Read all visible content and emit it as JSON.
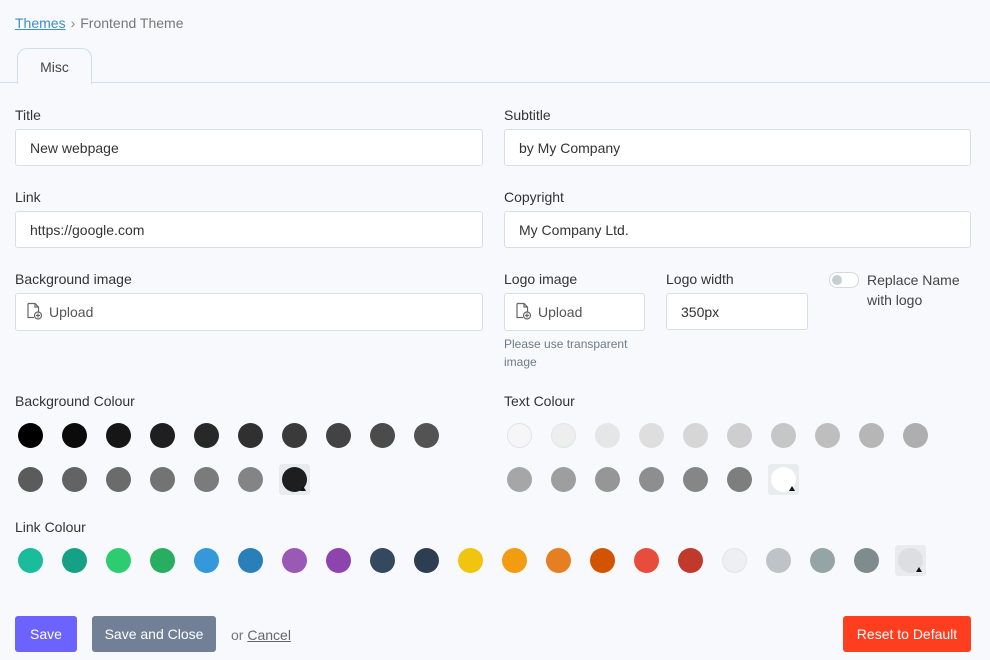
{
  "breadcrumb": {
    "link": "Themes",
    "separator": "›",
    "current": "Frontend Theme"
  },
  "tabs": [
    {
      "label": "Misc"
    }
  ],
  "fields": {
    "title": {
      "label": "Title",
      "value": "New webpage"
    },
    "subtitle": {
      "label": "Subtitle",
      "value": "by My Company"
    },
    "link": {
      "label": "Link",
      "value": "https://google.com"
    },
    "copyright": {
      "label": "Copyright",
      "value": "My Company Ltd."
    },
    "background_image": {
      "label": "Background image",
      "upload": "Upload"
    },
    "logo_image": {
      "label": "Logo image",
      "upload": "Upload",
      "hint": "Please use transparent image"
    },
    "logo_width": {
      "label": "Logo width",
      "value": "350px"
    },
    "replace_name": {
      "label": "Replace Name with logo",
      "checked": false
    }
  },
  "background_colour": {
    "label": "Background Colour",
    "swatches": [
      "#000000",
      "#0b0b0b",
      "#161616",
      "#1f1f1f",
      "#282828",
      "#303030",
      "#3a3a3a",
      "#434343",
      "#4b4b4b",
      "#535353",
      "#5b5b5b",
      "#636363",
      "#6b6b6b",
      "#737373",
      "#7b7b7b",
      "#848484"
    ],
    "selected": "#1e1e1e"
  },
  "text_colour": {
    "label": "Text Colour",
    "swatches": [
      "#f6f6f6",
      "#eeeeee",
      "#e6e6e6",
      "#dedede",
      "#d6d6d6",
      "#cecece",
      "#c6c6c6",
      "#bebebe",
      "#b6b6b6",
      "#aeaeae",
      "#a6a6a6",
      "#9e9e9e",
      "#969696",
      "#8e8e8e",
      "#868686",
      "#7e7e7e"
    ],
    "selected": "#ffffff"
  },
  "link_colour": {
    "label": "Link Colour",
    "swatches": [
      "#1abc9c",
      "#16a085",
      "#2ecc71",
      "#27ae60",
      "#3498db",
      "#2980b9",
      "#9b59b6",
      "#8e44ad",
      "#34495e",
      "#2c3e50",
      "#f1c40f",
      "#f39c12",
      "#e67e22",
      "#d35400",
      "#e74c3c",
      "#c0392b",
      "#ecf0f1",
      "#bdc3c7",
      "#95a5a6",
      "#7f8c8d"
    ],
    "selected": "#dcdfe2"
  },
  "actions": {
    "save": "Save",
    "save_close": "Save and Close",
    "or": "or",
    "cancel": "Cancel",
    "reset": "Reset to Default"
  },
  "colors": {
    "save": "#6c63ff",
    "save_close": "#718096",
    "reset": "#ff3d1f",
    "link": "#3d8fc7"
  },
  "icons": {
    "upload": "file-upload-icon"
  }
}
